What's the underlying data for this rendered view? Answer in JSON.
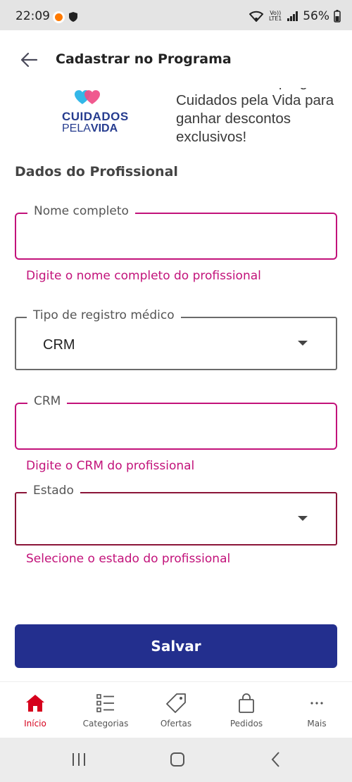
{
  "status_bar": {
    "time": "22:09",
    "signal_text": "Vo)) LTE1",
    "battery": "56%"
  },
  "app_bar": {
    "title": "Cadastrar no Programa"
  },
  "promo": {
    "logo_line1": "CUIDADOS",
    "logo_line2_a": "PELA",
    "logo_line2_b": "VIDA",
    "text": "Cadastre-se no programa Cuidados pela Vida para ganhar descontos exclusivos!"
  },
  "form": {
    "section_title": "Dados do Profissional",
    "nome": {
      "label": "Nome completo",
      "value": "",
      "helper": "Digite o nome completo do profissional"
    },
    "tipo_registro": {
      "label": "Tipo de registro médico",
      "value": "CRM"
    },
    "crm": {
      "label": "CRM",
      "value": "",
      "helper": "Digite o CRM do profissional"
    },
    "estado": {
      "label": "Estado",
      "value": "",
      "helper": "Selecione o estado do profissional"
    },
    "save_label": "Salvar"
  },
  "bottom_nav": {
    "items": [
      {
        "label": "Início",
        "icon": "home-icon",
        "active": true
      },
      {
        "label": "Categorias",
        "icon": "list-icon",
        "active": false
      },
      {
        "label": "Ofertas",
        "icon": "tag-icon",
        "active": false
      },
      {
        "label": "Pedidos",
        "icon": "bag-icon",
        "active": false
      },
      {
        "label": "Mais",
        "icon": "more-icon",
        "active": false
      }
    ]
  },
  "colors": {
    "primary": "#232f8e",
    "error": "#c2127a",
    "active_nav": "#d6001c"
  }
}
